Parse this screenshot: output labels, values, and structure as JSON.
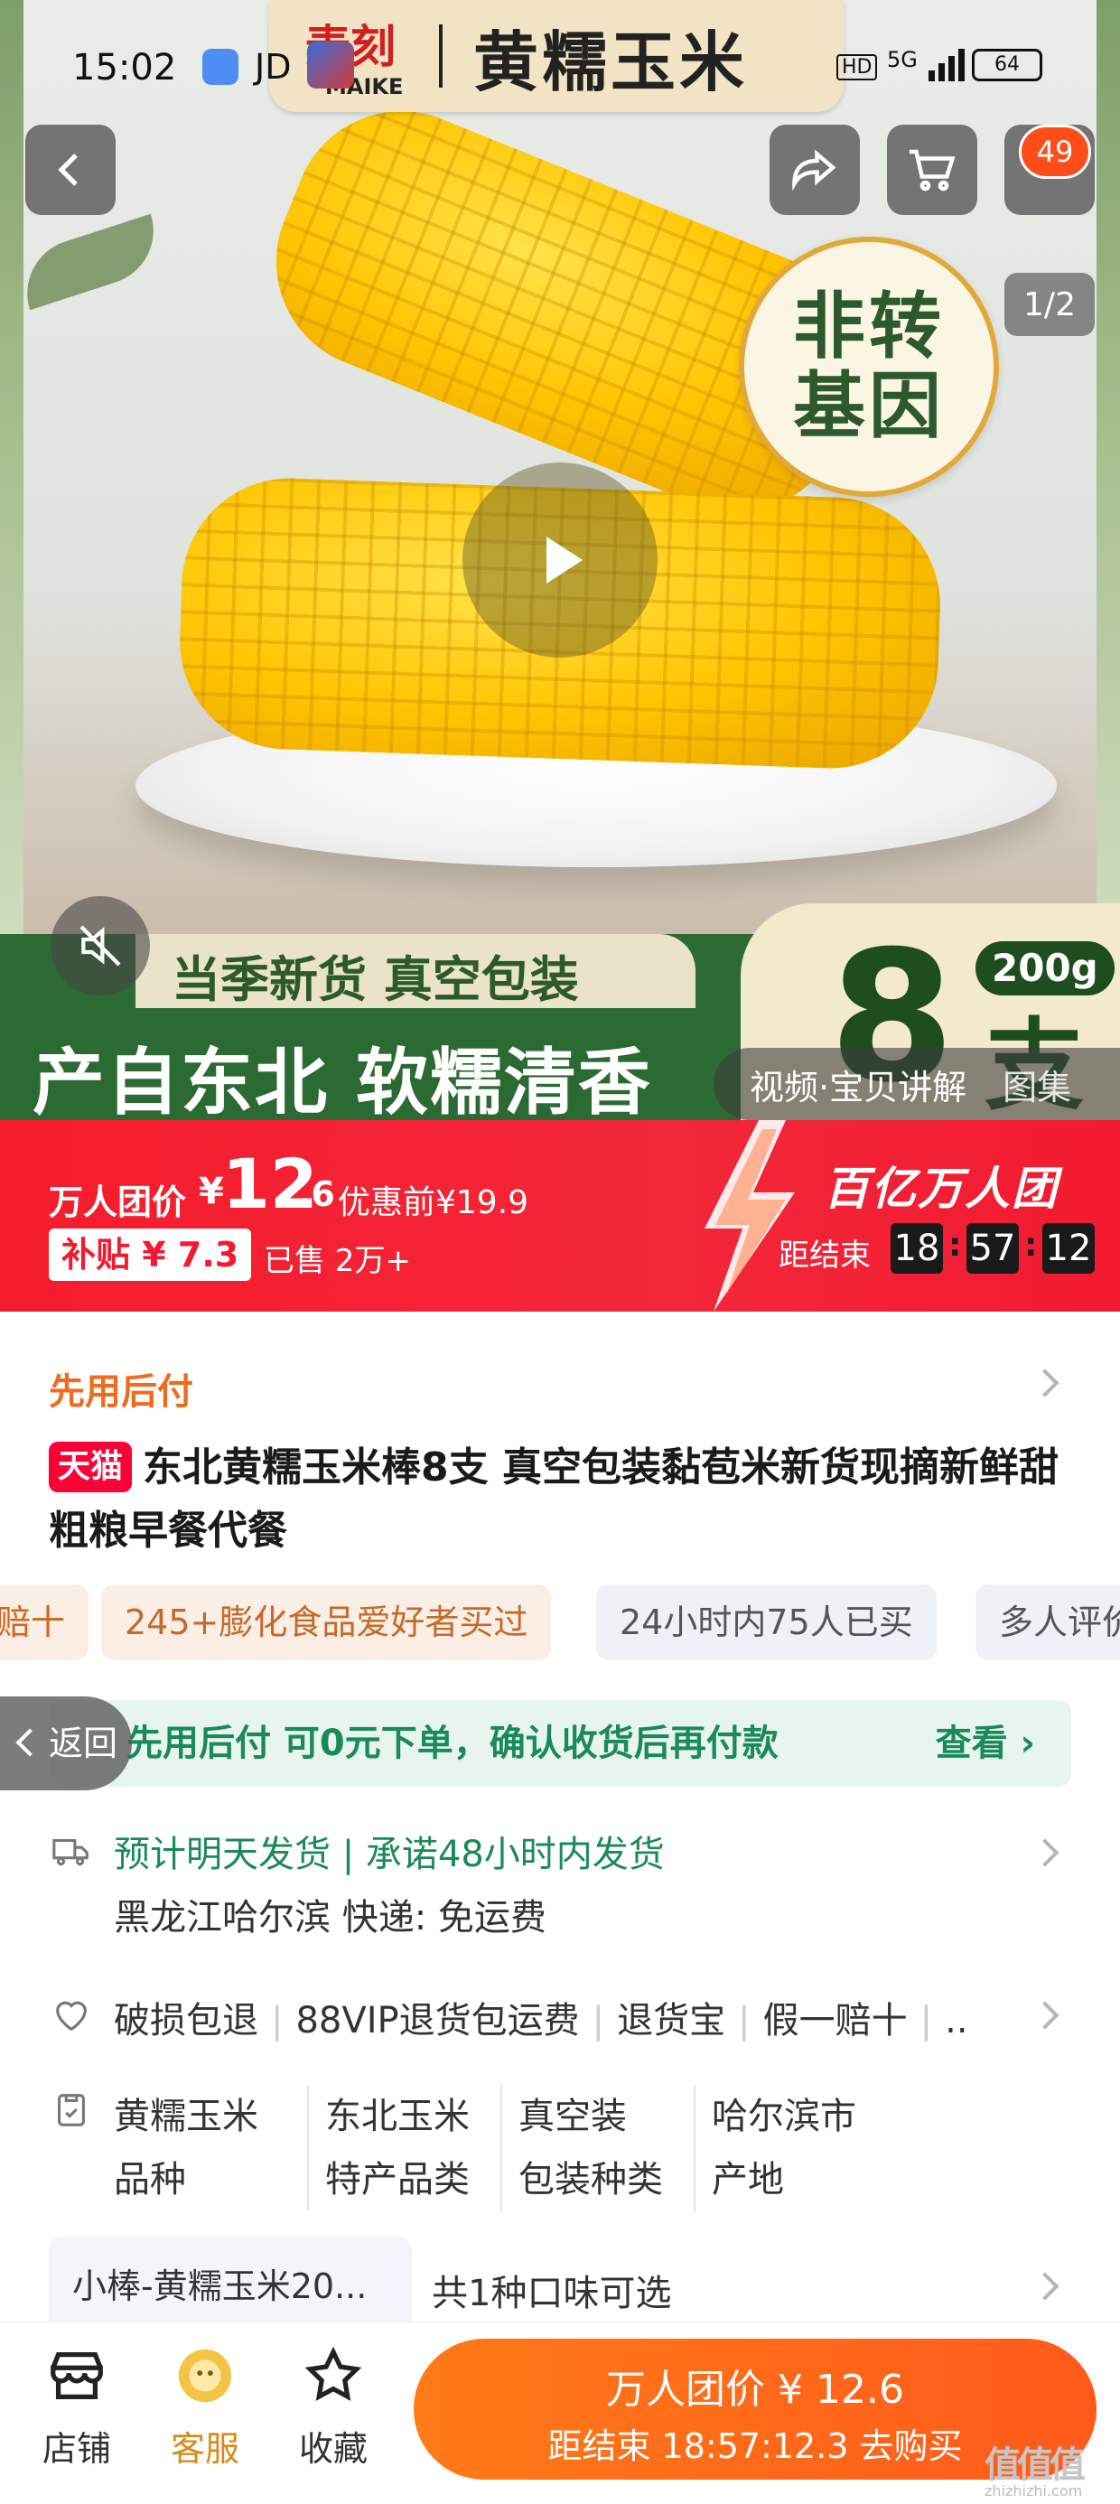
{
  "status_bar": {
    "time": "15:02",
    "carrier_app": "JD",
    "hd": "HD",
    "signal": "5G",
    "battery": "64"
  },
  "brand": {
    "logo_text": "麦刻",
    "logo_sub": "MAIKE",
    "title": "黄糯玉米"
  },
  "nav": {
    "cart_badge": "49",
    "image_counter": "1/2"
  },
  "hero": {
    "badge_line1": "非转",
    "badge_line2": "基因",
    "banner_upper": "当季新货 真空包装",
    "banner_lower": "产自东北 软糯清香",
    "count": "8",
    "count_unit": "支",
    "weight": "200g",
    "media_tabs": [
      "视频·宝贝讲解",
      "图集"
    ]
  },
  "promo": {
    "group_label": "万人团价",
    "currency": "¥",
    "price_int": "12",
    "price_dec": ".6",
    "original": "优惠前¥19.9",
    "subsidy": "补贴 ¥ 7.3",
    "sold": "已售 2万+",
    "event": "百亿万人团",
    "ends_label": "距结束",
    "countdown": [
      "18",
      "57",
      "12"
    ],
    "colon": ":"
  },
  "detail": {
    "pay_later": "先用后付",
    "tmall_tag": "天猫",
    "title": "东北黄糯玉米棒8支 真空包装黏苞米新货现摘新鲜甜粗粮早餐代餐",
    "tags": [
      "赔十",
      "245+膨化食品爱好者买过",
      "24小时内75人已买",
      "多人评价"
    ],
    "bnpl_text": "先用后付 可0元下单，确认收货后再付款",
    "bnpl_view": "查看 ›",
    "back_label": "返回",
    "shipping_line1": "预计明天发货 | 承诺48小时内发货",
    "shipping_line2": "黑龙江哈尔滨  快递: 免运费",
    "services": [
      "破损包退",
      "88VIP退货包运费",
      "退货宝",
      "假一赔十",
      ".."
    ],
    "attributes": [
      {
        "value": "黄糯玉米",
        "label": "品种"
      },
      {
        "value": "东北玉米",
        "label": "特产品类"
      },
      {
        "value": "真空装",
        "label": "包装种类"
      },
      {
        "value": "哈尔滨市",
        "label": "产地"
      }
    ],
    "variant": "小棒-黄糯玉米20...",
    "variant_count": "共1种口味可选"
  },
  "bottom_bar": {
    "store": "店铺",
    "service": "客服",
    "favorite": "收藏",
    "buy_line1": "万人团价 ¥ 12.6",
    "buy_line2": "距结束 18:57:12.3 去购买"
  },
  "watermark": {
    "text": "值值值",
    "url": "zhizhizhi.com"
  },
  "colors": {
    "promo_red": "#f3273a",
    "buy_orange": "#ff6a1a",
    "green_accent": "#1a8a5a",
    "tmall_red": "#ff0036"
  }
}
